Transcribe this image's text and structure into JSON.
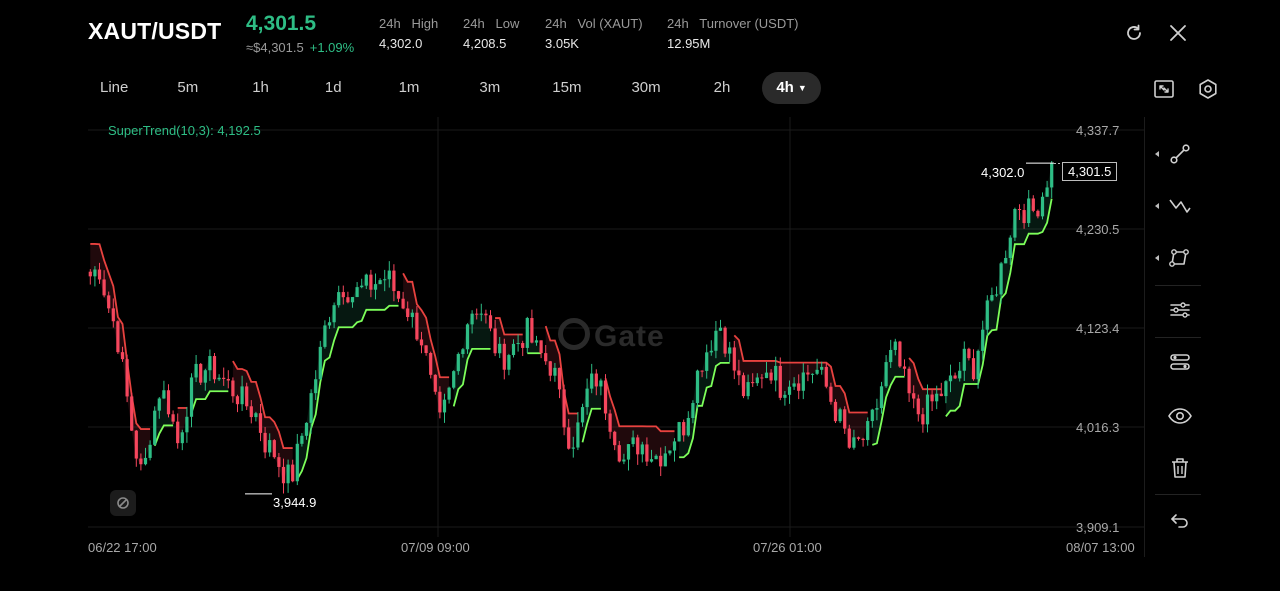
{
  "header": {
    "pair": "XAUT/USDT",
    "last_price": "4,301.5",
    "approx_usd": "≈$4,301.5",
    "change_pct": "+1.09%",
    "stats": [
      {
        "label": "24h   High",
        "value": "4,302.0"
      },
      {
        "label": "24h   Low",
        "value": "4,208.5"
      },
      {
        "label": "24h   Vol (XAUT)",
        "value": "3.05K"
      },
      {
        "label": "24h   Turnover (USDT)",
        "value": "12.95M"
      }
    ]
  },
  "timeframes": {
    "items": [
      "Line",
      "5m",
      "1h",
      "1d",
      "1m",
      "3m",
      "15m",
      "30m",
      "2h",
      "4h"
    ],
    "active": "4h"
  },
  "indicator": {
    "label": "SuperTrend(10,3): 4,192.5"
  },
  "watermark": "Gate",
  "price_axis": {
    "ticks": [
      "4,337.7",
      "4,230.5",
      "4,123.4",
      "4,016.3",
      "3,909.1"
    ],
    "current_price_tag": "4,301.5",
    "high_marker": "4,302.0",
    "low_marker": "3,944.9"
  },
  "time_axis": {
    "ticks": [
      "06/22 17:00",
      "07/09 09:00",
      "07/26 01:00",
      "08/07 13:00"
    ]
  },
  "colors": {
    "up": "#2ebd85",
    "down": "#f6465d",
    "supertrend_up": "#7dff5a",
    "supertrend_down": "#e8423f",
    "background": "#000000"
  },
  "chart_data": {
    "type": "candlestick",
    "instrument": "XAUT/USDT",
    "interval": "4h",
    "price_range": [
      3909.1,
      4337.7
    ],
    "grid": true,
    "price_path": [
      4180,
      4190,
      4150,
      4120,
      4060,
      4000,
      3960,
      4020,
      4060,
      4040,
      4000,
      4040,
      4070,
      4080,
      4080,
      4070,
      4060,
      4050,
      4040,
      4030,
      4000,
      3990,
      3970,
      3960,
      4000,
      4040,
      4080,
      4130,
      4160,
      4170,
      4160,
      4165,
      4170,
      4175,
      4180,
      4160,
      4150,
      4130,
      4110,
      4060,
      4020,
      4050,
      4090,
      4130,
      4150,
      4140,
      4110,
      4090,
      4100,
      4110,
      4120,
      4100,
      4090,
      4080,
      4030,
      4000,
      4020,
      4060,
      4070,
      4040,
      4010,
      3980,
      3995,
      4000,
      3990,
      3985,
      3995,
      4010,
      4020,
      4060,
      4090,
      4110,
      4130,
      4100,
      4070,
      4050,
      4060,
      4080,
      4080,
      4060,
      4070,
      4070,
      4075,
      4080,
      4065,
      4040,
      4020,
      3990,
      4000,
      4010,
      4040,
      4080,
      4100,
      4070,
      4040,
      4030,
      4040,
      4050,
      4060,
      4070,
      4090,
      4080,
      4120,
      4150,
      4180,
      4220,
      4260,
      4250,
      4250,
      4270,
      4302
    ]
  }
}
